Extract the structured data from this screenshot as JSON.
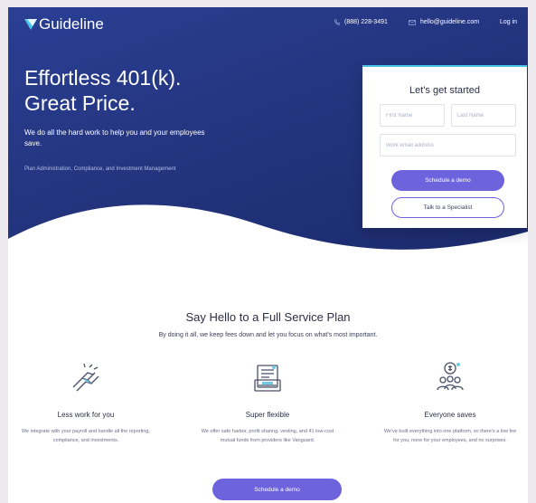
{
  "nav": {
    "logo_text": "Guideline",
    "phone": "(888) 228-3491",
    "email": "hello@guideline.com",
    "login": "Log in"
  },
  "hero": {
    "headline_line1": "Effortless 401(k).",
    "headline_line2": "Great Price.",
    "subtext": "We do all the hard work to help you and your employees save.",
    "tagline": "Plan Administration, Compliance, and Investment Management"
  },
  "signup_card": {
    "title": "Let's get started",
    "first_name_placeholder": "First Name",
    "last_name_placeholder": "Last Name",
    "email_placeholder": "Work email address",
    "primary_button": "Schedule a demo",
    "secondary_button": "Talk to a Specialist"
  },
  "section": {
    "title": "Say Hello to a Full Service Plan",
    "subtitle": "By doing it all, we keep fees down and let you focus on what's most important."
  },
  "features": [
    {
      "icon": "handshake-icon",
      "title": "Less work for you",
      "description": "We integrate with your payroll and handle all the reporting, compliance, and investments."
    },
    {
      "icon": "flexible-document-icon",
      "title": "Super flexible",
      "description": "We offer safe harbor, profit sharing, vesting, and 41 low-cost mutual funds from providers like Vanguard."
    },
    {
      "icon": "people-savings-icon",
      "title": "Everyone saves",
      "description": "We've built everything into one platform, so there's a low fee for you, none for your employees, and no surprises."
    }
  ],
  "bottom_button": "Schedule a demo",
  "colors": {
    "hero_blue": "#24357f",
    "accent_purple": "#6d63dc",
    "accent_cyan": "#4bc6e8"
  }
}
